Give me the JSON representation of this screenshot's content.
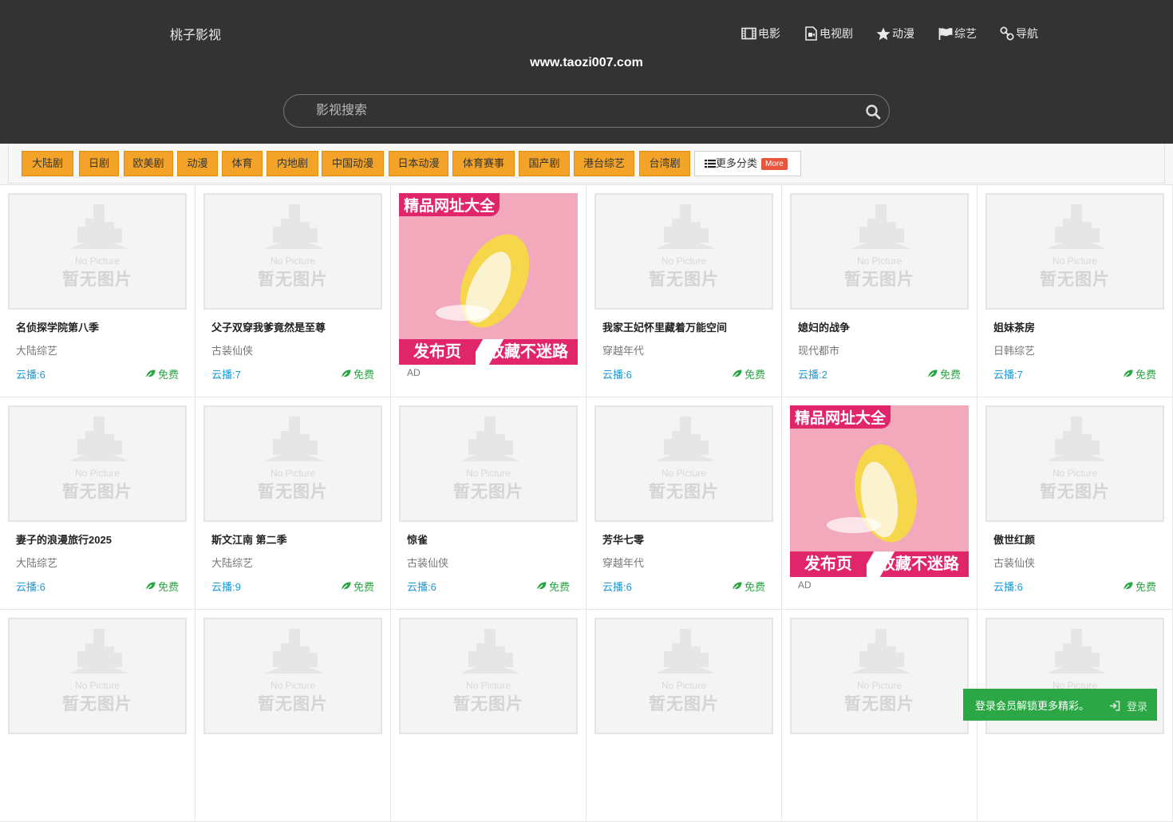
{
  "header": {
    "logo": "桃子影视",
    "domain": "www.taozi007.com",
    "nav": [
      {
        "label": "电影",
        "icon": "film-icon"
      },
      {
        "label": "电视剧",
        "icon": "video-file-icon"
      },
      {
        "label": "动漫",
        "icon": "star-icon"
      },
      {
        "label": "综艺",
        "icon": "flag-icon"
      },
      {
        "label": "导航",
        "icon": "link-icon"
      }
    ]
  },
  "search": {
    "placeholder": "影视搜索",
    "icon": "search-icon"
  },
  "categories": [
    "大陆剧",
    "日剧",
    "欧美剧",
    "动漫",
    "体育",
    "内地剧",
    "中国动漫",
    "日本动漫",
    "体育赛事",
    "国产剧",
    "港台综艺",
    "台湾剧"
  ],
  "more": {
    "label": "更多分类",
    "tag": "More",
    "icon": "list-icon"
  },
  "placeholder_text": {
    "en": "No Picture",
    "zh": "暂无图片"
  },
  "free_label": "免费",
  "ad": {
    "top": "精品网址大全",
    "bottom_left": "发布页",
    "bottom_right": "收藏不迷路",
    "label": "AD"
  },
  "row1": [
    {
      "title": "名侦探学院第八季",
      "sub": "大陆综艺",
      "count": "云播:6"
    },
    {
      "title": "父子双穿我爹竟然是至尊",
      "sub": "古装仙侠",
      "count": "云播:7"
    },
    {
      "ad": true
    },
    {
      "title": "我家王妃怀里藏着万能空间",
      "sub": "穿越年代",
      "count": "云播:6"
    },
    {
      "title": "媳妇的战争",
      "sub": "现代都市",
      "count": "云播:2"
    },
    {
      "title": "姐妹茶房",
      "sub": "日韩综艺",
      "count": "云播:7"
    }
  ],
  "row2": [
    {
      "title": "妻子的浪漫旅行2025",
      "sub": "大陆综艺",
      "count": "云播:6"
    },
    {
      "title": "斯文江南 第二季",
      "sub": "大陆综艺",
      "count": "云播:9"
    },
    {
      "title": "惊雀",
      "sub": "古装仙侠",
      "count": "云播:6"
    },
    {
      "title": "芳华七零",
      "sub": "穿越年代",
      "count": "云播:6"
    },
    {
      "ad": true
    },
    {
      "title": "傲世红颜",
      "sub": "古装仙侠",
      "count": "云播:6"
    }
  ],
  "login": {
    "message": "登录会员解锁更多精彩。",
    "button": "登录"
  }
}
